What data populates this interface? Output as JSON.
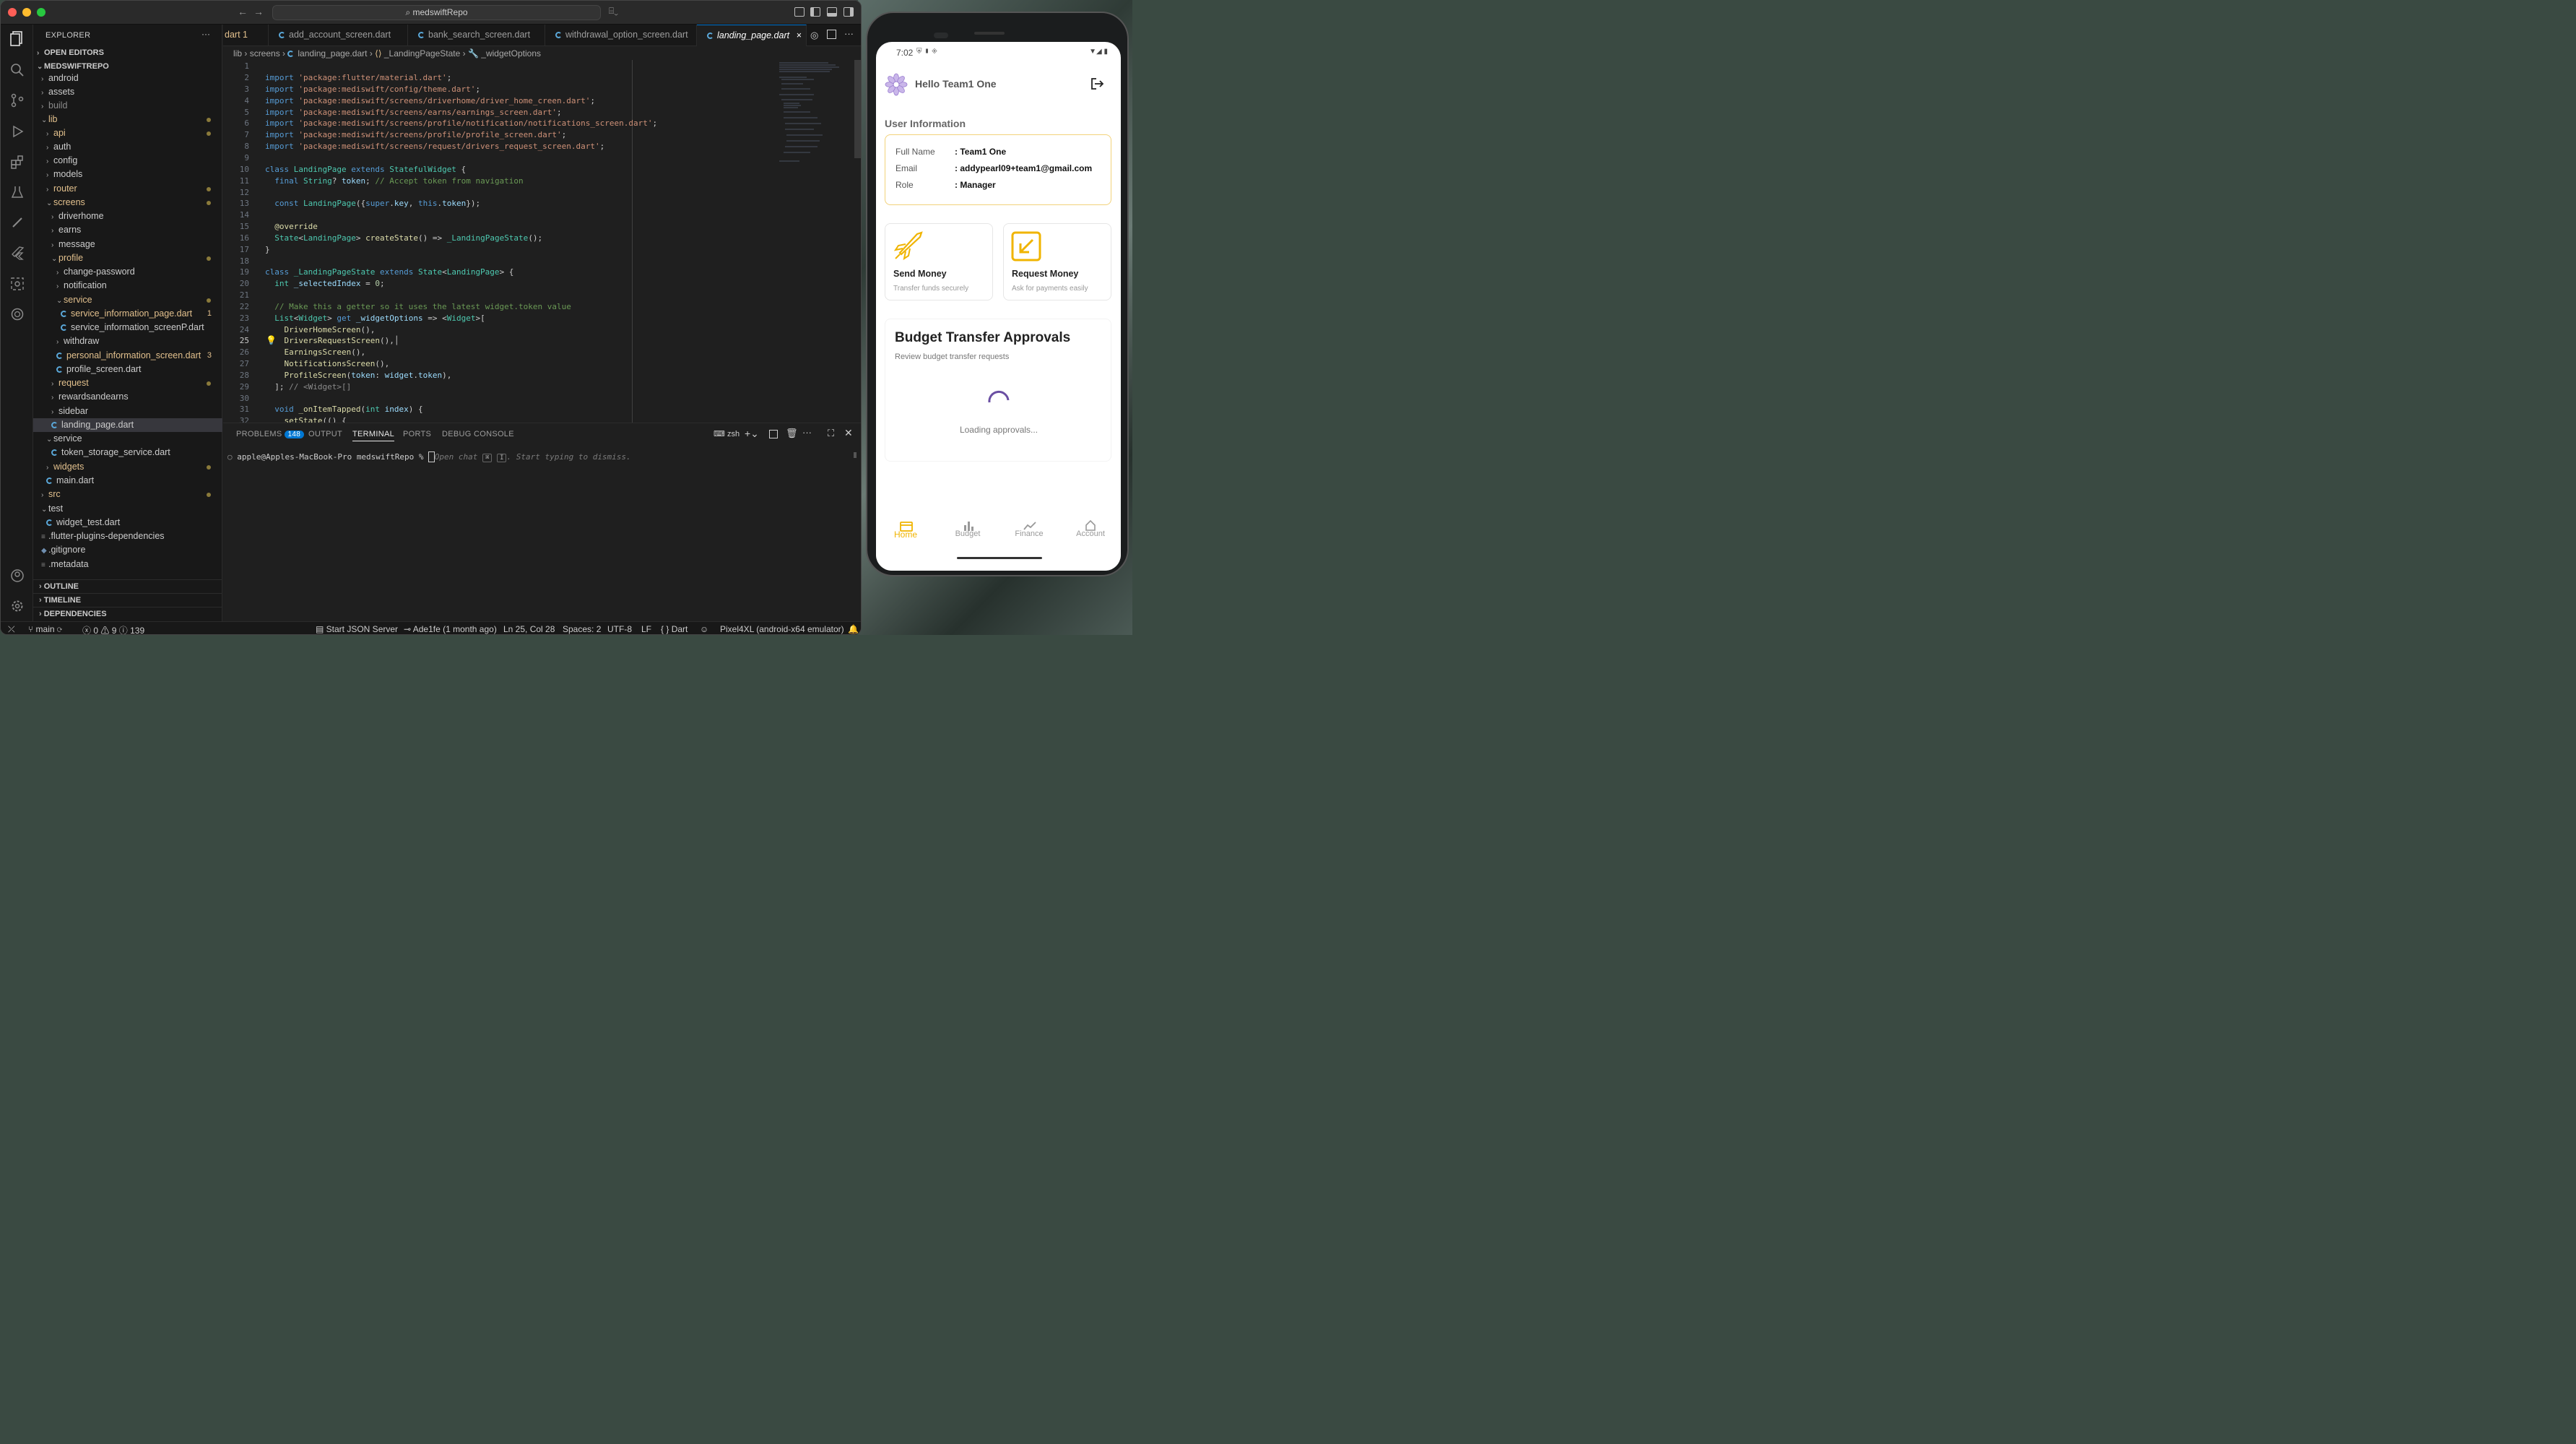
{
  "window": {
    "search_text": "medswiftRepo"
  },
  "explorer": {
    "title": "EXPLORER",
    "more": "···",
    "open_editors": "OPEN EDITORS",
    "root": "MEDSWIFTREPO",
    "items": [
      "android",
      "assets",
      "build",
      "lib",
      "api",
      "auth",
      "config",
      "models",
      "router",
      "screens",
      "driverhome",
      "earns",
      "message",
      "profile",
      "change-password",
      "notification",
      "service",
      "service_information_page.dart",
      "service_information_screenP.dart",
      "withdraw",
      "personal_information_screen.dart",
      "profile_screen.dart",
      "request",
      "rewardsandearns",
      "sidebar",
      "landing_page.dart",
      "service",
      "token_storage_service.dart",
      "widgets",
      "main.dart",
      "src",
      "test",
      "widget_test.dart",
      ".flutter-plugins-dependencies",
      ".gitignore",
      ".metadata"
    ],
    "problem_counts": {
      "service_information_page": "1",
      "personal_information_screen": "3"
    },
    "outline": "OUTLINE",
    "timeline": "TIMELINE",
    "dependencies": "DEPENDENCIES"
  },
  "tabs": [
    "dart 1",
    "add_account_screen.dart",
    "bank_search_screen.dart",
    "withdrawal_option_screen.dart",
    "landing_page.dart"
  ],
  "breadcrumb": [
    "lib",
    "screens",
    "landing_page.dart",
    "_LandingPageState",
    "_widgetOptions"
  ],
  "editor": {
    "line_numbers": [
      "1",
      "2",
      "3",
      "4",
      "5",
      "6",
      "7",
      "8",
      "9",
      "10",
      "11",
      "12",
      "13",
      "14",
      "15",
      "16",
      "17",
      "18",
      "19",
      "20",
      "21",
      "22",
      "23",
      "24",
      "25",
      "26",
      "27",
      "28",
      "29",
      "30",
      "31",
      "32"
    ],
    "imports": [
      "'package:flutter/material.dart'",
      "'package:mediswift/config/theme.dart'",
      "'package:mediswift/screens/driverhome/driver_home_creen.dart'",
      "'package:mediswift/screens/earns/earnings_screen.dart'",
      "'package:mediswift/screens/profile/notification/notifications_screen.dart'",
      "'package:mediswift/screens/profile/profile_screen.dart'",
      "'package:mediswift/screens/request/drivers_request_screen.dart'"
    ],
    "comment_token": "// Accept token from navigation",
    "comment_getter": "// Make this a getter so it uses the latest widget.token value",
    "comment_list": "// <Widget>[]"
  },
  "panel": {
    "tabs": [
      "PROBLEMS",
      "OUTPUT",
      "TERMINAL",
      "PORTS",
      "DEBUG CONSOLE"
    ],
    "problems_count": "148",
    "shell": "zsh",
    "prompt": "apple@Apples-MacBook-Pro medswiftRepo %",
    "ghost_hint_a": "Open chat",
    "kbd1": "⌘",
    "kbd2": "I",
    "ghost_hint_b": ". Start typing to dismiss."
  },
  "status_bar": {
    "branch": "main",
    "errors": "0",
    "warnings": "9",
    "infos": "139",
    "json_server": "Start JSON Server",
    "commit": "Ade1fe (1 month ago)",
    "cursor": "Ln 25, Col 28",
    "spaces": "Spaces: 2",
    "encoding": "UTF-8",
    "eol": "LF",
    "language": "Dart",
    "device": "Pixel4XL (android-x64 emulator)"
  },
  "phone": {
    "time": "7:02",
    "greeting": "Hello Team1 One",
    "section_title": "User Information",
    "fields": [
      {
        "label": "Full Name",
        "value": ": Team1 One"
      },
      {
        "label": "Email",
        "value": ": addypearl09+team1@gmail.com"
      },
      {
        "label": "Role",
        "value": ": Manager"
      }
    ],
    "actions": [
      {
        "title": "Send Money",
        "subtitle": "Transfer funds securely"
      },
      {
        "title": "Request Money",
        "subtitle": "Ask for payments easily"
      }
    ],
    "approvals_title": "Budget Transfer Approvals",
    "approvals_subtitle": "Review budget transfer requests",
    "loading": "Loading approvals...",
    "nav": [
      "Home",
      "Budget",
      "Finance",
      "Account"
    ],
    "accent_color": "#f0b400"
  }
}
